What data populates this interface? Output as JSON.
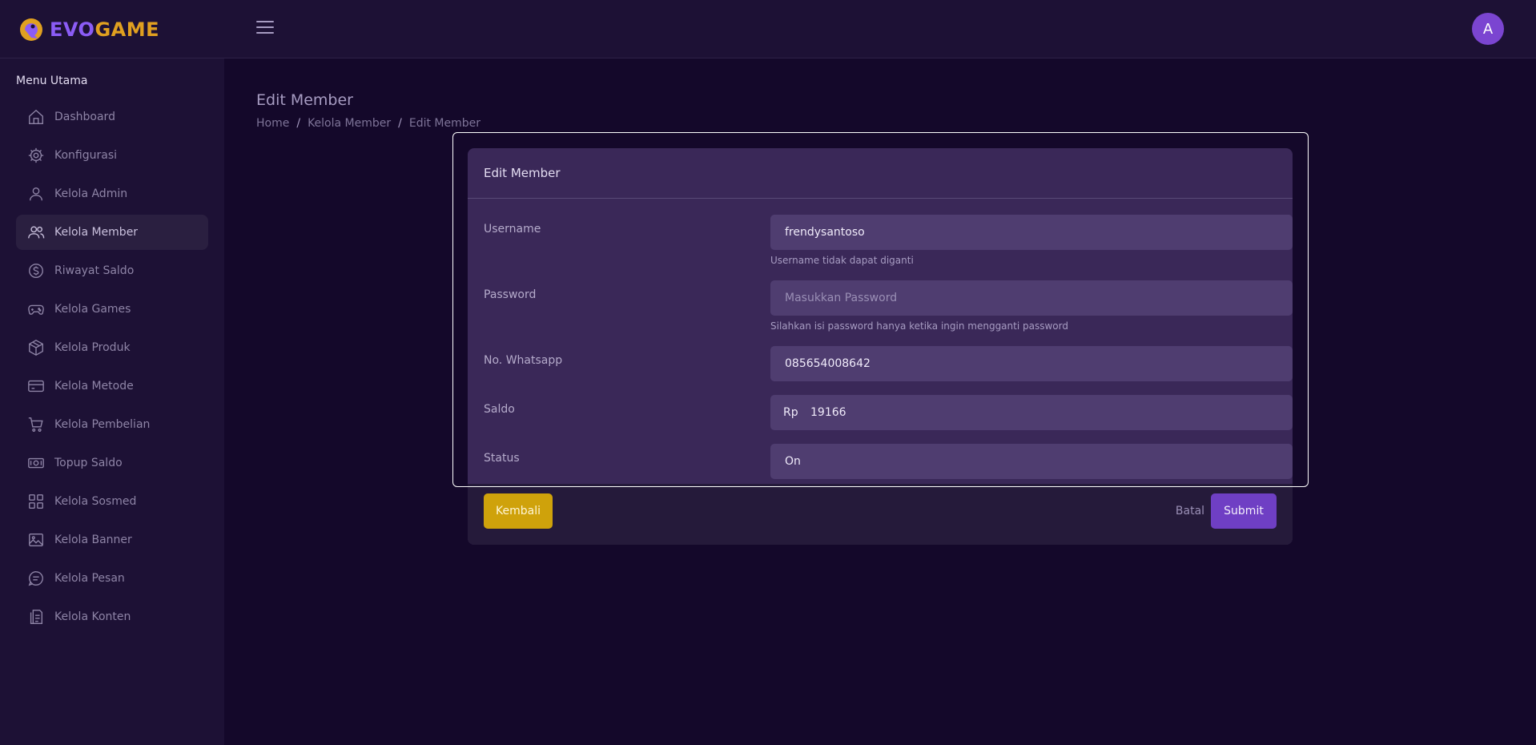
{
  "brand": {
    "name_part1": "EVO",
    "name_part2": "GAME"
  },
  "header": {
    "avatar_initial": "A"
  },
  "sidebar": {
    "heading": "Menu Utama",
    "items": [
      {
        "label": "Dashboard",
        "icon": "home-icon",
        "active": false
      },
      {
        "label": "Konfigurasi",
        "icon": "gear-icon",
        "active": false
      },
      {
        "label": "Kelola Admin",
        "icon": "user-icon",
        "active": false
      },
      {
        "label": "Kelola Member",
        "icon": "users-icon",
        "active": true
      },
      {
        "label": "Riwayat Saldo",
        "icon": "dollar-circle-icon",
        "active": false
      },
      {
        "label": "Kelola Games",
        "icon": "gamepad-icon",
        "active": false
      },
      {
        "label": "Kelola Produk",
        "icon": "box-icon",
        "active": false
      },
      {
        "label": "Kelola Metode",
        "icon": "credit-card-icon",
        "active": false
      },
      {
        "label": "Kelola Pembelian",
        "icon": "cart-icon",
        "active": false
      },
      {
        "label": "Topup Saldo",
        "icon": "money-icon",
        "active": false
      },
      {
        "label": "Kelola Sosmed",
        "icon": "grid-icon",
        "active": false
      },
      {
        "label": "Kelola Banner",
        "icon": "image-icon",
        "active": false
      },
      {
        "label": "Kelola Pesan",
        "icon": "chat-icon",
        "active": false
      },
      {
        "label": "Kelola Konten",
        "icon": "document-icon",
        "active": false
      }
    ]
  },
  "page": {
    "title": "Edit Member",
    "breadcrumb": [
      "Home",
      "Kelola Member",
      "Edit Member"
    ],
    "breadcrumb_separator": "/"
  },
  "form": {
    "card_title": "Edit Member",
    "username": {
      "label": "Username",
      "value": "frendysantoso",
      "hint": "Username tidak dapat diganti"
    },
    "password": {
      "label": "Password",
      "value": "",
      "placeholder": "Masukkan Password",
      "hint": "Silahkan isi password hanya ketika ingin mengganti password"
    },
    "whatsapp": {
      "label": "No. Whatsapp",
      "value": "085654008642"
    },
    "saldo": {
      "label": "Saldo",
      "prefix": "Rp",
      "value": "19166"
    },
    "status": {
      "label": "Status",
      "value": "On"
    }
  },
  "actions": {
    "back_label": "Kembali",
    "cancel_label": "Batal",
    "submit_label": "Submit"
  },
  "colors": {
    "background": "#14082a",
    "sidebar": "#1d1135",
    "card": "#3a2858",
    "field": "#4f3d70",
    "accent": "#6f3fc4",
    "warning": "#cfa20b"
  }
}
